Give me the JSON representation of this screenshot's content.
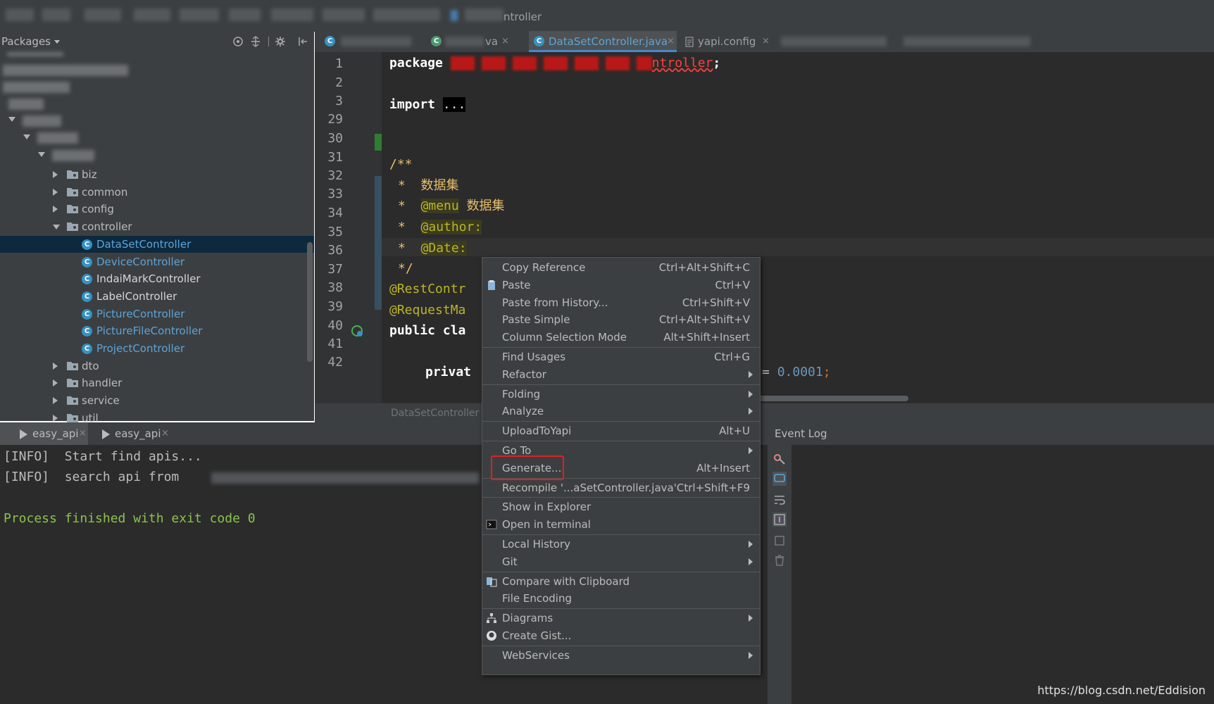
{
  "breadcrumb": {
    "last": "ntroller"
  },
  "project": {
    "title": "Packages",
    "tree": [
      {
        "label": "biz",
        "type": "folder",
        "indent": 3
      },
      {
        "label": "common",
        "type": "folder",
        "indent": 3
      },
      {
        "label": "config",
        "type": "folder",
        "indent": 3
      },
      {
        "label": "controller",
        "type": "folder-open",
        "indent": 3
      },
      {
        "label": "DataSetController",
        "type": "class",
        "indent": 4,
        "selected": true
      },
      {
        "label": "DeviceController",
        "type": "class",
        "indent": 4
      },
      {
        "label": "IndaiMarkController",
        "type": "class",
        "indent": 4,
        "white": true
      },
      {
        "label": "LabelController",
        "type": "class",
        "indent": 4,
        "white": true
      },
      {
        "label": "PictureController",
        "type": "class",
        "indent": 4
      },
      {
        "label": "PictureFileController",
        "type": "class",
        "indent": 4
      },
      {
        "label": "ProjectController",
        "type": "class",
        "indent": 4
      },
      {
        "label": "dto",
        "type": "folder",
        "indent": 3
      },
      {
        "label": "handler",
        "type": "folder",
        "indent": 3
      },
      {
        "label": "service",
        "type": "folder",
        "indent": 3
      },
      {
        "label": "util",
        "type": "folder",
        "indent": 3
      }
    ]
  },
  "tabs": {
    "tab2_suffix": "va",
    "active": "DataSetController.java",
    "config": "yapi.config",
    "close": "×"
  },
  "editor": {
    "line_numbers": [
      "1",
      "2",
      "3",
      "29",
      "30",
      "31",
      "32",
      "33",
      "34",
      "35",
      "36",
      "37",
      "38",
      "39",
      "40",
      "41",
      "42"
    ],
    "package_kw": "package",
    "package_tail": "ntroller",
    "semicolon": ";",
    "import_kw": "import",
    "import_dots": "...",
    "doc_open": "/**",
    "doc_star": "*",
    "doc_title": "数据集",
    "menu_tag": "@menu",
    "menu_value": "数据集",
    "author_tag": "@author:",
    "date_tag": "@Date:",
    "doc_close": "*/",
    "rest_ann": "@RestContr",
    "req_ann": "@RequestMa",
    "public_cla": "public cla",
    "privat": "privat",
    "eq": "=",
    "num_value": "0.0001",
    "footer": "DataSetController"
  },
  "run": {
    "tabs": [
      "easy_api",
      "easy_api"
    ],
    "close": "×",
    "lines": [
      "[INFO]  Start find apis...",
      "[INFO]  search api from"
    ],
    "exit": "Process finished with exit code 0"
  },
  "event_log": {
    "title": "Event Log"
  },
  "context_menu": {
    "items": [
      {
        "label": "Copy Reference",
        "shortcut": "Ctrl+Alt+Shift+C"
      },
      {
        "label": "Paste",
        "shortcut": "Ctrl+V",
        "icon": "paste-icon"
      },
      {
        "label": "Paste from History...",
        "shortcut": "Ctrl+Shift+V"
      },
      {
        "label": "Paste Simple",
        "shortcut": "Ctrl+Alt+Shift+V"
      },
      {
        "label": "Column Selection Mode",
        "shortcut": "Alt+Shift+Insert"
      },
      {
        "sep": true
      },
      {
        "label": "Find Usages",
        "shortcut": "Ctrl+G"
      },
      {
        "label": "Refactor",
        "submenu": true
      },
      {
        "sep": true
      },
      {
        "label": "Folding",
        "submenu": true
      },
      {
        "label": "Analyze",
        "submenu": true
      },
      {
        "sep": true
      },
      {
        "label": "UploadToYapi",
        "shortcut": "Alt+U"
      },
      {
        "sep": true
      },
      {
        "label": "Go To",
        "submenu": true
      },
      {
        "label": "Generate...",
        "shortcut": "Alt+Insert"
      },
      {
        "sep": true
      },
      {
        "label": "Recompile '...aSetController.java'",
        "shortcut": "Ctrl+Shift+F9"
      },
      {
        "sep": true
      },
      {
        "label": "Show in Explorer"
      },
      {
        "label": "Open in terminal",
        "icon": "terminal-icon"
      },
      {
        "sep": true
      },
      {
        "label": "Local History",
        "submenu": true
      },
      {
        "label": "Git",
        "submenu": true
      },
      {
        "sep": true
      },
      {
        "label": "Compare with Clipboard",
        "icon": "compare-icon"
      },
      {
        "label": "File Encoding"
      },
      {
        "sep": true
      },
      {
        "label": "Diagrams",
        "submenu": true,
        "icon": "diagram-icon"
      },
      {
        "label": "Create Gist...",
        "icon": "github-icon"
      },
      {
        "sep": true
      },
      {
        "label": "WebServices",
        "submenu": true
      }
    ]
  },
  "watermark": "https://blog.csdn.net/Eddision"
}
